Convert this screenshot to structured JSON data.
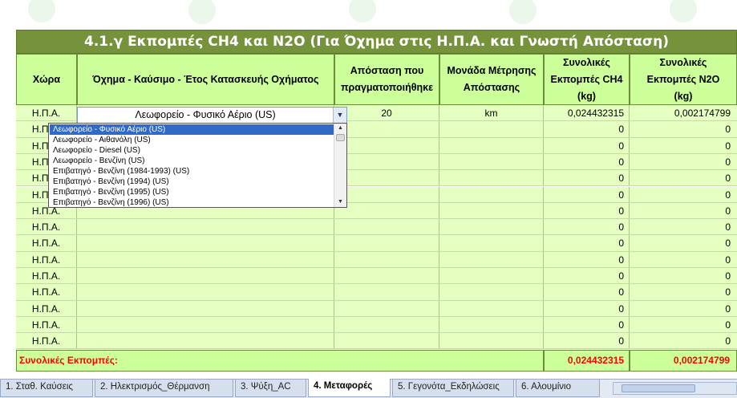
{
  "sheet_title": "4.1.γ Εκπομπές CH4 και N2O (Για Όχημα στις Η.Π.Α. και Γνωστή Απόσταση)",
  "headers": {
    "country": "Χώρα",
    "vehicle": "Όχημα - Καύσιμο - Έτος Κατασκευής Οχήματος",
    "distance": "Απόσταση που\nπραγματοποιήθηκε",
    "unit": "Μονάδα Μέτρησης\nΑπόστασης",
    "ch4": "Συνολικές\nΕκπομπές CH4\n(kg)",
    "n2o": "Συνολικές\nΕκπομπές N2O\n(kg)"
  },
  "rows": [
    {
      "country": "Η.Π.Α.",
      "vehicle": "Λεωφορείο - Φυσικό Αέριο (US)",
      "distance": "20",
      "unit": "km",
      "ch4": "0,024432315",
      "n2o": "0,002174799"
    },
    {
      "country": "Η.Π.Α.",
      "vehicle": "",
      "distance": "",
      "unit": "",
      "ch4": "0",
      "n2o": "0"
    },
    {
      "country": "Η.Π.Α.",
      "vehicle": "",
      "distance": "",
      "unit": "",
      "ch4": "0",
      "n2o": "0"
    },
    {
      "country": "Η.Π.Α.",
      "vehicle": "",
      "distance": "",
      "unit": "",
      "ch4": "0",
      "n2o": "0"
    },
    {
      "country": "Η.Π.Α.",
      "vehicle": "",
      "distance": "",
      "unit": "",
      "ch4": "0",
      "n2o": "0"
    },
    {
      "country": "Η.Π.Α.",
      "vehicle": "",
      "distance": "",
      "unit": "",
      "ch4": "0",
      "n2o": "0"
    },
    {
      "country": "Η.Π.Α.",
      "vehicle": "",
      "distance": "",
      "unit": "",
      "ch4": "0",
      "n2o": "0"
    },
    {
      "country": "Η.Π.Α.",
      "vehicle": "",
      "distance": "",
      "unit": "",
      "ch4": "0",
      "n2o": "0"
    },
    {
      "country": "Η.Π.Α.",
      "vehicle": "",
      "distance": "",
      "unit": "",
      "ch4": "0",
      "n2o": "0"
    },
    {
      "country": "Η.Π.Α.",
      "vehicle": "",
      "distance": "",
      "unit": "",
      "ch4": "0",
      "n2o": "0"
    },
    {
      "country": "Η.Π.Α.",
      "vehicle": "",
      "distance": "",
      "unit": "",
      "ch4": "0",
      "n2o": "0"
    },
    {
      "country": "Η.Π.Α.",
      "vehicle": "",
      "distance": "",
      "unit": "",
      "ch4": "0",
      "n2o": "0"
    },
    {
      "country": "Η.Π.Α.",
      "vehicle": "",
      "distance": "",
      "unit": "",
      "ch4": "0",
      "n2o": "0"
    },
    {
      "country": "Η.Π.Α.",
      "vehicle": "",
      "distance": "",
      "unit": "",
      "ch4": "0",
      "n2o": "0"
    },
    {
      "country": "Η.Π.Α.",
      "vehicle": "",
      "distance": "",
      "unit": "",
      "ch4": "0",
      "n2o": "0"
    }
  ],
  "dropdown": {
    "selected": "Λεωφορείο - Φυσικό Αέριο (US)",
    "options": [
      "Λεωφορείο - Φυσικό Αέριο (US)",
      "Λεωφορείο - Αιθανόλη (US)",
      "Λεωφορείο - Diesel (US)",
      "Λεωφορείο - Βενζίνη (US)",
      "Επιβατηγό - Βενζίνη (1984-1993) (US)",
      "Επιβατηγό - Βενζίνη (1994) (US)",
      "Επιβατηγό - Βενζίνη (1995) (US)",
      "Επιβατηγό - Βενζίνη (1996) (US)"
    ]
  },
  "totals": {
    "label": "Συνολικές Εκπομπές:",
    "ch4": "0,024432315",
    "n2o": "0,002174799"
  },
  "tabs": [
    "1. Σταθ. Καύσεις",
    "2. Ηλεκτρισμός_Θέρμανση",
    "3. Ψύξη_AC",
    "4. Μεταφορές",
    "5. Γεγονότα_Εκδηλώσεις",
    "6. Αλουμίνιο"
  ],
  "active_tab": "4. Μεταφορές",
  "colors": {
    "title_bg": "#76933c",
    "header_bg": "#ccff99",
    "cell_bg": "#e4ffbf",
    "total_text": "#ff0000",
    "dropdown_selected": "#3169c6"
  }
}
